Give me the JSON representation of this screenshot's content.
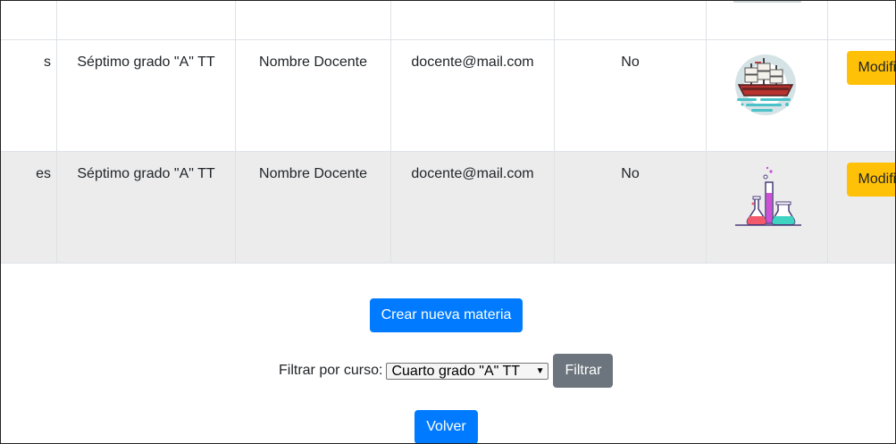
{
  "table": {
    "rows": [
      {
        "name": "s",
        "course": "Séptimo grado \"A\" TT",
        "teacher": "Nombre Docente",
        "email": "docente@mail.com",
        "flag": "No",
        "image": "ship-icon",
        "action": "Modificar"
      },
      {
        "name": "es",
        "course": "Séptimo grado \"A\" TT",
        "teacher": "Nombre Docente",
        "email": "docente@mail.com",
        "flag": "No",
        "image": "lab-flasks-icon",
        "action": "Modificar"
      }
    ]
  },
  "actions": {
    "create_label": "Crear nueva materia",
    "back_label": "Volver"
  },
  "filter": {
    "label": "Filtrar por curso:",
    "selected": "Cuarto grado \"A\" TT",
    "button_label": "Filtrar"
  },
  "colors": {
    "primary": "#007bff",
    "secondary": "#6c757d",
    "warning": "#ffc107",
    "striped_row": "#ececec"
  }
}
